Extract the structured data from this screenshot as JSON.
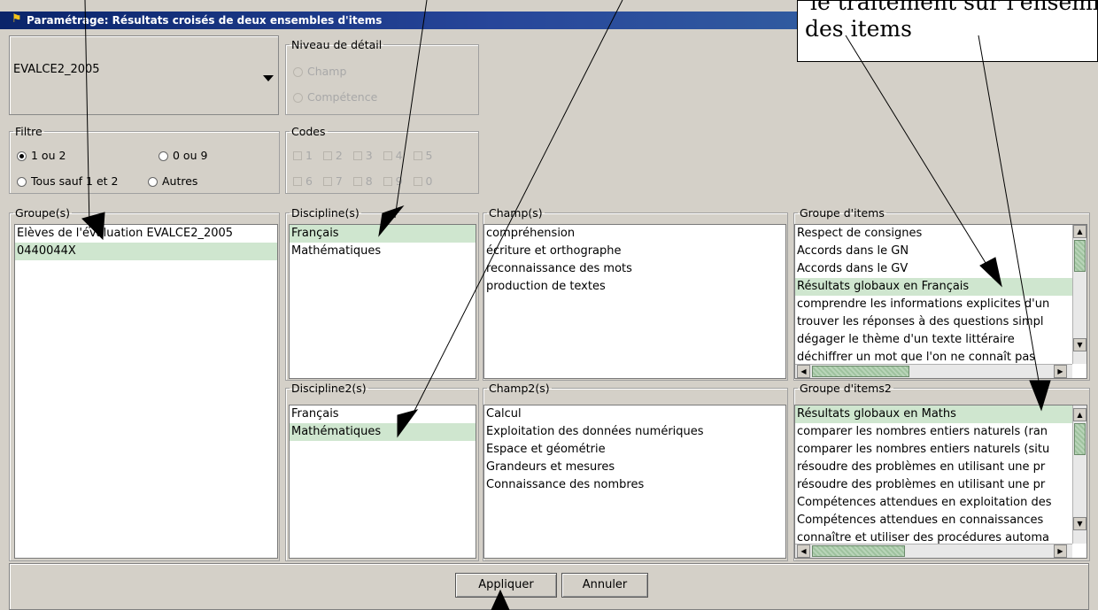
{
  "window": {
    "title": "Paramétrage: Résultats croisés de deux ensembles d'items",
    "title_icon": "app-icon"
  },
  "evaluation_select": {
    "value": "EVALCE2_2005"
  },
  "niveau": {
    "legend": "Niveau de détail",
    "options": [
      "Champ",
      "Compétence"
    ]
  },
  "filtre": {
    "legend": "Filtre",
    "options": [
      "1 ou 2",
      "0 ou 9",
      "Tous sauf 1 et 2",
      "Autres"
    ],
    "selected": "1 ou 2"
  },
  "codes": {
    "legend": "Codes",
    "row1": [
      "1",
      "2",
      "3",
      "4",
      "5"
    ],
    "row2": [
      "6",
      "7",
      "8",
      "9",
      "0"
    ]
  },
  "groupes": {
    "legend": "Groupe(s)",
    "items": [
      "Elèves de l'évaluation EVALCE2_2005",
      "0440044X"
    ],
    "selected_index": 1
  },
  "discipline": {
    "legend": "Discipline(s)",
    "items": [
      "Français",
      "Mathématiques"
    ],
    "selected_index": 0
  },
  "champ": {
    "legend": "Champ(s)",
    "items": [
      "compréhension",
      "écriture et orthographe",
      "reconnaissance des mots",
      "production de textes"
    ]
  },
  "groupe_items": {
    "legend": "Groupe d'items",
    "items": [
      "Respect de consignes",
      "Accords dans le GN",
      "Accords dans le GV",
      "Résultats globaux en Français",
      "comprendre les informations explicites d'un",
      "trouver les réponses à des questions simpl",
      "dégager le thème d'un texte littéraire",
      "déchiffrer un mot que l'on ne connaît pas"
    ],
    "selected_index": 3
  },
  "discipline2": {
    "legend": "Discipline2(s)",
    "items": [
      "Français",
      "Mathématiques"
    ],
    "selected_index": 1
  },
  "champ2": {
    "legend": "Champ2(s)",
    "items": [
      "Calcul",
      "Exploitation des données numériques",
      "Espace et géométrie",
      "Grandeurs et mesures",
      "Connaissance des nombres"
    ]
  },
  "groupe_items2": {
    "legend": "Groupe d'items2",
    "items": [
      "Résultats globaux en Maths",
      "comparer les nombres entiers naturels (ran",
      "comparer les nombres entiers naturels (situ",
      "résoudre des problèmes en utilisant une pr",
      "résoudre des problèmes en utilisant une pr",
      "Compétences attendues en exploitation des",
      "Compétences attendues en connaissances",
      "connaître et utiliser des procédures automa"
    ],
    "selected_index": 0
  },
  "buttons": {
    "apply": "Appliquer",
    "cancel": "Annuler"
  },
  "callout": {
    "line1": "le traitement sur l'ensemble",
    "line2": "des items"
  },
  "colors": {
    "selection": "#cfe6cf",
    "titlebar": "#0a246a",
    "panel": "#d4d0c8"
  }
}
